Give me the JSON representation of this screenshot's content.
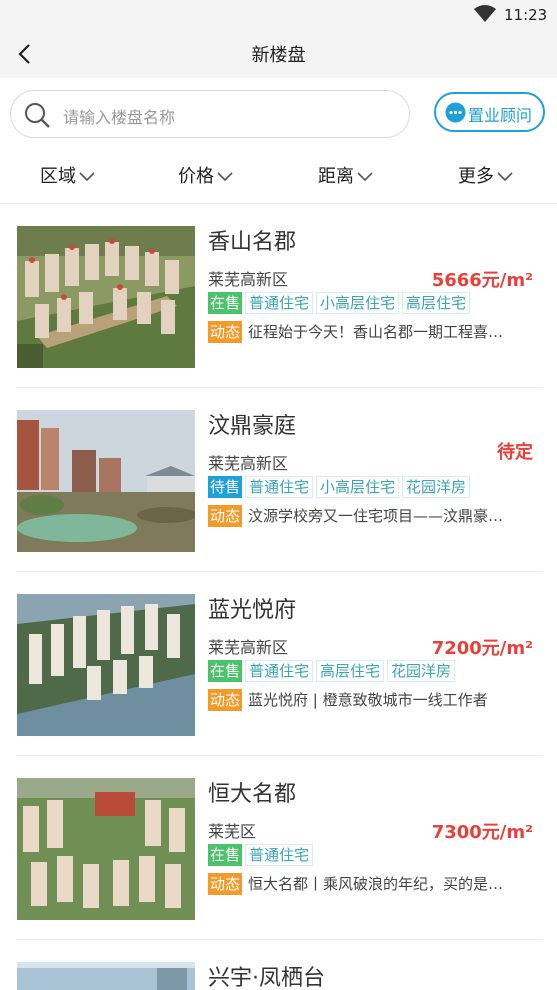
{
  "status_bar": {
    "time": "11:23"
  },
  "nav": {
    "title": "新楼盘"
  },
  "search": {
    "placeholder": "请输入楼盘名称",
    "advisor_label": "置业顾问"
  },
  "filters": [
    {
      "label": "区域"
    },
    {
      "label": "价格"
    },
    {
      "label": "距离"
    },
    {
      "label": "更多"
    }
  ],
  "listings": [
    {
      "name": "香山名郡",
      "area": "莱芜高新区",
      "price": "5666元/m²",
      "status": "在售",
      "types": [
        "普通住宅",
        "小高层住宅",
        "高层住宅"
      ],
      "news_label": "动态",
      "news": "征程始于今天！香山名郡一期工程喜…"
    },
    {
      "name": "汶鼎豪庭",
      "area": "莱芜高新区",
      "price": "待定",
      "status": "待售",
      "types": [
        "普通住宅",
        "小高层住宅",
        "花园洋房"
      ],
      "news_label": "动态",
      "news": "汶源学校旁又一住宅项目——汶鼎豪…"
    },
    {
      "name": "蓝光悦府",
      "area": "莱芜高新区",
      "price": "7200元/m²",
      "status": "在售",
      "types": [
        "普通住宅",
        "高层住宅",
        "花园洋房"
      ],
      "news_label": "动态",
      "news": "蓝光悦府 | 橙意致敬城市一线工作者"
    },
    {
      "name": "恒大名都",
      "area": "莱芜区",
      "price": "7300元/m²",
      "status": "在售",
      "types": [
        "普通住宅"
      ],
      "news_label": "动态",
      "news": "恒大名都丨乘风破浪的年纪，买的是…"
    },
    {
      "name": "兴宇·凤栖台"
    }
  ],
  "colors": {
    "accent": "#1ea0d8",
    "price": "#e8413a",
    "on_sale": "#4bc36a",
    "news_badge": "#f39a2b",
    "tag_text": "#3aa6b6"
  }
}
